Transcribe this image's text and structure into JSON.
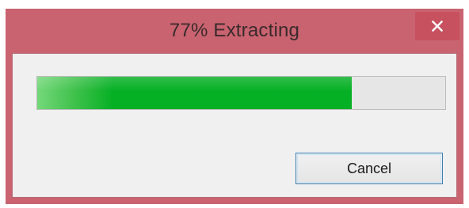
{
  "window": {
    "title": "77% Extracting",
    "close_icon": "close-icon"
  },
  "progress": {
    "value": 0.77
  },
  "buttons": {
    "cancel_label": "Cancel"
  },
  "colors": {
    "frame": "#c96370",
    "close_button": "#c7515f",
    "progress_fill": "#06b025",
    "button_border": "#3c7fb1"
  }
}
